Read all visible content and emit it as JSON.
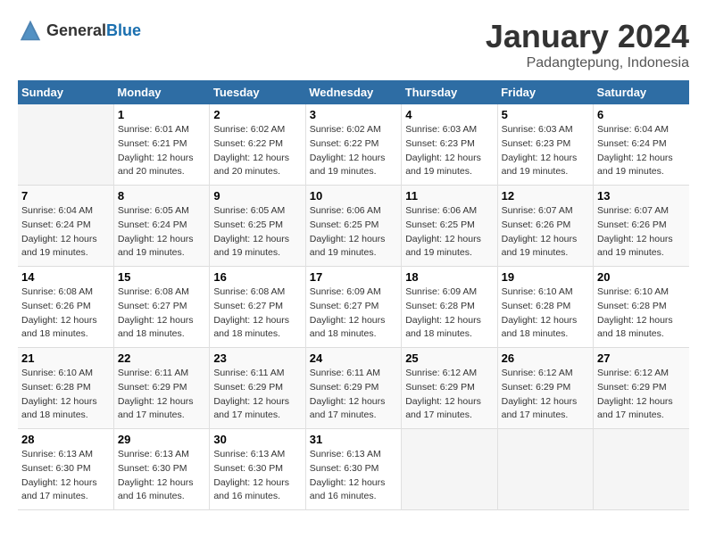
{
  "header": {
    "logo_general": "General",
    "logo_blue": "Blue",
    "month_year": "January 2024",
    "location": "Padangtepung, Indonesia"
  },
  "days_of_week": [
    "Sunday",
    "Monday",
    "Tuesday",
    "Wednesday",
    "Thursday",
    "Friday",
    "Saturday"
  ],
  "weeks": [
    [
      {
        "num": "",
        "sunrise": "",
        "sunset": "",
        "daylight": "",
        "empty": true
      },
      {
        "num": "1",
        "sunrise": "Sunrise: 6:01 AM",
        "sunset": "Sunset: 6:21 PM",
        "daylight": "Daylight: 12 hours and 20 minutes."
      },
      {
        "num": "2",
        "sunrise": "Sunrise: 6:02 AM",
        "sunset": "Sunset: 6:22 PM",
        "daylight": "Daylight: 12 hours and 20 minutes."
      },
      {
        "num": "3",
        "sunrise": "Sunrise: 6:02 AM",
        "sunset": "Sunset: 6:22 PM",
        "daylight": "Daylight: 12 hours and 19 minutes."
      },
      {
        "num": "4",
        "sunrise": "Sunrise: 6:03 AM",
        "sunset": "Sunset: 6:23 PM",
        "daylight": "Daylight: 12 hours and 19 minutes."
      },
      {
        "num": "5",
        "sunrise": "Sunrise: 6:03 AM",
        "sunset": "Sunset: 6:23 PM",
        "daylight": "Daylight: 12 hours and 19 minutes."
      },
      {
        "num": "6",
        "sunrise": "Sunrise: 6:04 AM",
        "sunset": "Sunset: 6:24 PM",
        "daylight": "Daylight: 12 hours and 19 minutes."
      }
    ],
    [
      {
        "num": "7",
        "sunrise": "Sunrise: 6:04 AM",
        "sunset": "Sunset: 6:24 PM",
        "daylight": "Daylight: 12 hours and 19 minutes."
      },
      {
        "num": "8",
        "sunrise": "Sunrise: 6:05 AM",
        "sunset": "Sunset: 6:24 PM",
        "daylight": "Daylight: 12 hours and 19 minutes."
      },
      {
        "num": "9",
        "sunrise": "Sunrise: 6:05 AM",
        "sunset": "Sunset: 6:25 PM",
        "daylight": "Daylight: 12 hours and 19 minutes."
      },
      {
        "num": "10",
        "sunrise": "Sunrise: 6:06 AM",
        "sunset": "Sunset: 6:25 PM",
        "daylight": "Daylight: 12 hours and 19 minutes."
      },
      {
        "num": "11",
        "sunrise": "Sunrise: 6:06 AM",
        "sunset": "Sunset: 6:25 PM",
        "daylight": "Daylight: 12 hours and 19 minutes."
      },
      {
        "num": "12",
        "sunrise": "Sunrise: 6:07 AM",
        "sunset": "Sunset: 6:26 PM",
        "daylight": "Daylight: 12 hours and 19 minutes."
      },
      {
        "num": "13",
        "sunrise": "Sunrise: 6:07 AM",
        "sunset": "Sunset: 6:26 PM",
        "daylight": "Daylight: 12 hours and 19 minutes."
      }
    ],
    [
      {
        "num": "14",
        "sunrise": "Sunrise: 6:08 AM",
        "sunset": "Sunset: 6:26 PM",
        "daylight": "Daylight: 12 hours and 18 minutes."
      },
      {
        "num": "15",
        "sunrise": "Sunrise: 6:08 AM",
        "sunset": "Sunset: 6:27 PM",
        "daylight": "Daylight: 12 hours and 18 minutes."
      },
      {
        "num": "16",
        "sunrise": "Sunrise: 6:08 AM",
        "sunset": "Sunset: 6:27 PM",
        "daylight": "Daylight: 12 hours and 18 minutes."
      },
      {
        "num": "17",
        "sunrise": "Sunrise: 6:09 AM",
        "sunset": "Sunset: 6:27 PM",
        "daylight": "Daylight: 12 hours and 18 minutes."
      },
      {
        "num": "18",
        "sunrise": "Sunrise: 6:09 AM",
        "sunset": "Sunset: 6:28 PM",
        "daylight": "Daylight: 12 hours and 18 minutes."
      },
      {
        "num": "19",
        "sunrise": "Sunrise: 6:10 AM",
        "sunset": "Sunset: 6:28 PM",
        "daylight": "Daylight: 12 hours and 18 minutes."
      },
      {
        "num": "20",
        "sunrise": "Sunrise: 6:10 AM",
        "sunset": "Sunset: 6:28 PM",
        "daylight": "Daylight: 12 hours and 18 minutes."
      }
    ],
    [
      {
        "num": "21",
        "sunrise": "Sunrise: 6:10 AM",
        "sunset": "Sunset: 6:28 PM",
        "daylight": "Daylight: 12 hours and 18 minutes."
      },
      {
        "num": "22",
        "sunrise": "Sunrise: 6:11 AM",
        "sunset": "Sunset: 6:29 PM",
        "daylight": "Daylight: 12 hours and 17 minutes."
      },
      {
        "num": "23",
        "sunrise": "Sunrise: 6:11 AM",
        "sunset": "Sunset: 6:29 PM",
        "daylight": "Daylight: 12 hours and 17 minutes."
      },
      {
        "num": "24",
        "sunrise": "Sunrise: 6:11 AM",
        "sunset": "Sunset: 6:29 PM",
        "daylight": "Daylight: 12 hours and 17 minutes."
      },
      {
        "num": "25",
        "sunrise": "Sunrise: 6:12 AM",
        "sunset": "Sunset: 6:29 PM",
        "daylight": "Daylight: 12 hours and 17 minutes."
      },
      {
        "num": "26",
        "sunrise": "Sunrise: 6:12 AM",
        "sunset": "Sunset: 6:29 PM",
        "daylight": "Daylight: 12 hours and 17 minutes."
      },
      {
        "num": "27",
        "sunrise": "Sunrise: 6:12 AM",
        "sunset": "Sunset: 6:29 PM",
        "daylight": "Daylight: 12 hours and 17 minutes."
      }
    ],
    [
      {
        "num": "28",
        "sunrise": "Sunrise: 6:13 AM",
        "sunset": "Sunset: 6:30 PM",
        "daylight": "Daylight: 12 hours and 17 minutes."
      },
      {
        "num": "29",
        "sunrise": "Sunrise: 6:13 AM",
        "sunset": "Sunset: 6:30 PM",
        "daylight": "Daylight: 12 hours and 16 minutes."
      },
      {
        "num": "30",
        "sunrise": "Sunrise: 6:13 AM",
        "sunset": "Sunset: 6:30 PM",
        "daylight": "Daylight: 12 hours and 16 minutes."
      },
      {
        "num": "31",
        "sunrise": "Sunrise: 6:13 AM",
        "sunset": "Sunset: 6:30 PM",
        "daylight": "Daylight: 12 hours and 16 minutes."
      },
      {
        "num": "",
        "sunrise": "",
        "sunset": "",
        "daylight": "",
        "empty": true
      },
      {
        "num": "",
        "sunrise": "",
        "sunset": "",
        "daylight": "",
        "empty": true
      },
      {
        "num": "",
        "sunrise": "",
        "sunset": "",
        "daylight": "",
        "empty": true
      }
    ]
  ]
}
